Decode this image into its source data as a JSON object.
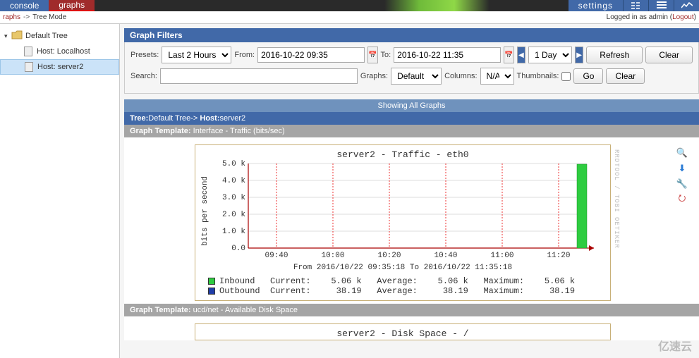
{
  "tabs": {
    "console": "console",
    "graphs": "graphs",
    "settings": "settings"
  },
  "breadcrumb": {
    "left": "raphs",
    "mode": "Tree Mode",
    "login_prefix": "Logged in as ",
    "user": "admin",
    "logout": "Logout"
  },
  "sidebar": {
    "root": "Default Tree",
    "items": [
      {
        "label": "Host: Localhost"
      },
      {
        "label": "Host: server2"
      }
    ],
    "selected": 1
  },
  "filters": {
    "title": "Graph Filters",
    "presets_lbl": "Presets:",
    "preset": "Last 2 Hours",
    "from_lbl": "From:",
    "from": "2016-10-22 09:35",
    "to_lbl": "To:",
    "to": "2016-10-22 11:35",
    "span": "1 Day",
    "refresh": "Refresh",
    "clear": "Clear",
    "search_lbl": "Search:",
    "search": "",
    "graphs_lbl": "Graphs:",
    "graphs_sel": "Default",
    "columns_lbl": "Columns:",
    "columns_sel": "N/A",
    "thumbs_lbl": "Thumbnails:",
    "go": "Go",
    "clear2": "Clear"
  },
  "banner": {
    "all": "Showing All Graphs",
    "tree_pre": "Tree:",
    "tree": "Default Tree",
    "arrow": "-> ",
    "host_pre": "Host:",
    "host": "server2",
    "tpl_pre": "Graph Template: ",
    "tpl1": "Interface - Traffic (bits/sec)",
    "tpl2": "ucd/net - Available Disk Space"
  },
  "graph2_title": "server2 - Disk Space - /",
  "chart_data": {
    "type": "bar",
    "title": "server2 - Traffic - eth0",
    "ylabel": "bits per second",
    "x_ticks": [
      "09:40",
      "10:00",
      "10:20",
      "10:40",
      "11:00",
      "11:20"
    ],
    "y_ticks": [
      0.0,
      1.0,
      2.0,
      3.0,
      4.0,
      5.0
    ],
    "y_unit": "k",
    "ylim": [
      0,
      5.5
    ],
    "caption": "From 2016/10/22 09:35:18 To 2016/10/22 11:35:18",
    "series": [
      {
        "name": "Inbound",
        "color": "#2ecc40",
        "current": "5.06 k",
        "average": "5.06 k",
        "maximum": "5.06 k"
      },
      {
        "name": "Outbound",
        "color": "#1f3da8",
        "current": "38.19",
        "average": "38.19",
        "maximum": "38.19"
      }
    ],
    "data_note": "Only one visible bar near right edge: Inbound ≈ 5.06k at ~11:30; rest of range has no plotted data."
  },
  "watermark": "亿速云"
}
